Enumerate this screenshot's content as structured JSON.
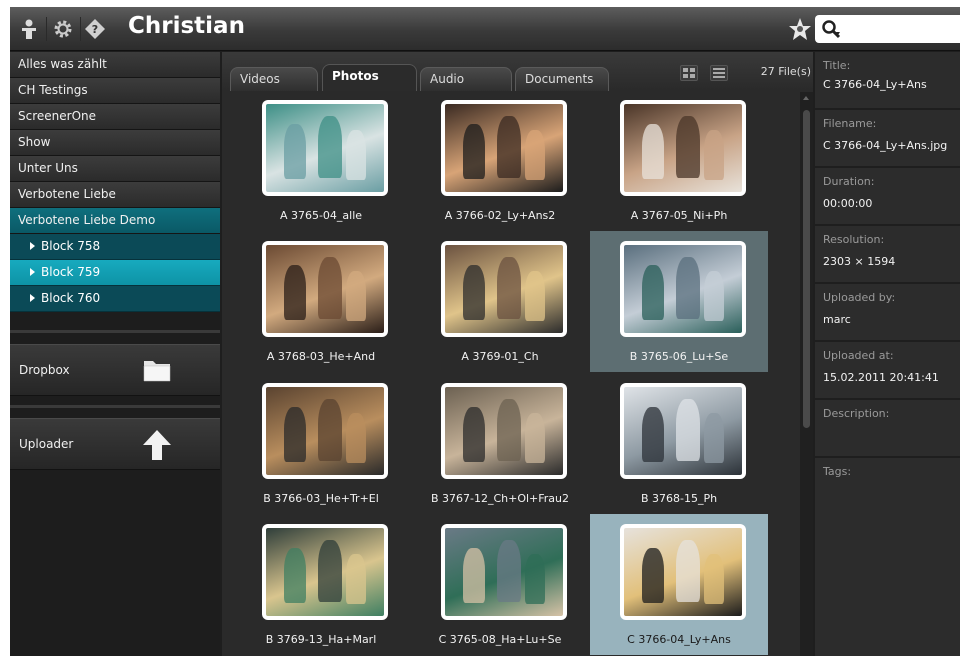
{
  "topbar": {
    "user_name": "Christian",
    "search": {
      "value": ""
    }
  },
  "sidebar": {
    "items": [
      {
        "label": "Alles was zählt"
      },
      {
        "label": "CH Testings"
      },
      {
        "label": "ScreenerOne"
      },
      {
        "label": "Show"
      },
      {
        "label": "Unter Uns"
      },
      {
        "label": "Verbotene Liebe"
      },
      {
        "label": "Verbotene Liebe Demo"
      }
    ],
    "subitems": [
      {
        "label": "Block 758"
      },
      {
        "label": "Block 759"
      },
      {
        "label": "Block 760"
      }
    ],
    "dropbox_label": "Dropbox",
    "uploader_label": "Uploader"
  },
  "tabs": {
    "videos": "Videos",
    "photos": "Photos",
    "audio": "Audio",
    "documents": "Documents",
    "file_count": "27 File(s)"
  },
  "grid": {
    "items": [
      {
        "caption": "A 3765-04_alle",
        "c": [
          "#3d8f86",
          "#d9e3e3",
          "#6a9ea3"
        ]
      },
      {
        "caption": "A 3766-02_Ly+Ans2",
        "c": [
          "#3a2a22",
          "#d8a477",
          "#1c1c1c"
        ]
      },
      {
        "caption": "A 3767-05_Ni+Ph",
        "c": [
          "#4a3528",
          "#c8a386",
          "#e8e2da"
        ]
      },
      {
        "caption": "A 3768-03_He+And",
        "c": [
          "#6b4a33",
          "#d2aa7f",
          "#2a1e18"
        ]
      },
      {
        "caption": "A 3769-01_Ch",
        "c": [
          "#6b5240",
          "#e0c48a",
          "#2c2c2c"
        ]
      },
      {
        "caption": "B 3765-06_Lu+Se",
        "c": [
          "#5a6f7e",
          "#c4cdd6",
          "#2a5f5a"
        ]
      },
      {
        "caption": "B 3766-03_He+Tr+El",
        "c": [
          "#5a4330",
          "#b98e5e",
          "#2a2a2a"
        ]
      },
      {
        "caption": "B 3767-12_Ch+Ol+Frau2",
        "c": [
          "#6c6152",
          "#c8b49a",
          "#2b2b2b"
        ]
      },
      {
        "caption": "B 3768-15_Ph",
        "c": [
          "#dfe3e7",
          "#8e9aa3",
          "#2c3238"
        ]
      },
      {
        "caption": "B 3769-13_Ha+Marl",
        "c": [
          "#2f3e3a",
          "#d9c58e",
          "#3f7f62"
        ]
      },
      {
        "caption": "C 3765-08_Ha+Lu+Se",
        "c": [
          "#6a7a86",
          "#2f6e57",
          "#d6c2a6"
        ]
      },
      {
        "caption": "C 3766-04_Ly+Ans",
        "c": [
          "#e6e2dc",
          "#e2c07a",
          "#1c1c1c"
        ]
      }
    ]
  },
  "details": {
    "title_label": "Title:",
    "title_value": "C 3766-04_Ly+Ans",
    "filename_label": "Filename:",
    "filename_value": "C 3766-04_Ly+Ans.jpg",
    "duration_label": "Duration:",
    "duration_value": "00:00:00",
    "resolution_label": "Resolution:",
    "resolution_value": "2303 × 1594",
    "uploaded_by_label": "Uploaded by:",
    "uploaded_by_value": "marc",
    "uploaded_at_label": "Uploaded at:",
    "uploaded_at_value": "15.02.2011 20:41:41",
    "description_label": "Description:",
    "tags_label": "Tags:"
  }
}
